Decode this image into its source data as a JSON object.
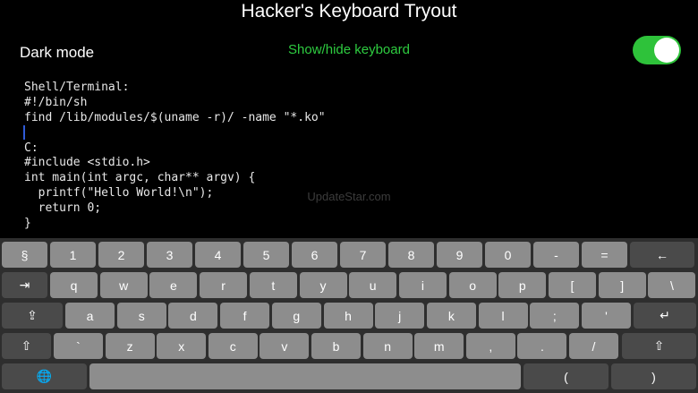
{
  "header": {
    "title": "Hacker's Keyboard Tryout",
    "dark_mode_label": "Dark mode",
    "show_hide_label": "Show/hide keyboard",
    "toggle_on": true,
    "toggle_color": "#2ec23a"
  },
  "editor": {
    "lines": [
      "Shell/Terminal:",
      "#!/bin/sh",
      "find /lib/modules/$(uname -r)/ -name \"*.ko\"",
      "",
      "C:",
      "#include <stdio.h>",
      "int main(int argc, char** argv) {",
      "  printf(\"Hello World!\\n\");",
      "  return 0;",
      "}"
    ]
  },
  "watermark": "UpdateStar.com",
  "keyboard": {
    "row1": [
      "§",
      "1",
      "2",
      "3",
      "4",
      "5",
      "6",
      "7",
      "8",
      "9",
      "0",
      "-",
      "=",
      "←"
    ],
    "row2": [
      "⇥",
      "q",
      "w",
      "e",
      "r",
      "t",
      "y",
      "u",
      "i",
      "o",
      "p",
      "[",
      "]",
      "\\"
    ],
    "row3": [
      "⇪",
      "a",
      "s",
      "d",
      "f",
      "g",
      "h",
      "j",
      "k",
      "l",
      ";",
      "'",
      "↵"
    ],
    "row4": [
      "⇧",
      "`",
      "z",
      "x",
      "c",
      "v",
      "b",
      "n",
      "m",
      ",",
      ".",
      "/",
      "⇧"
    ],
    "row5": [
      "🌐",
      "",
      "(",
      ")"
    ]
  }
}
